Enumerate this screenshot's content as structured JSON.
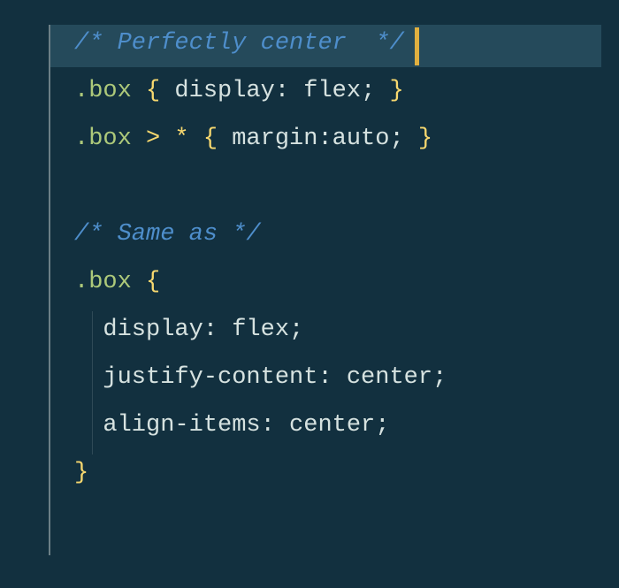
{
  "editor": {
    "lines": [
      {
        "highlighted": true,
        "tokens": [
          {
            "cls": "c-comment",
            "text": "/* Perfectly center  */"
          }
        ]
      },
      {
        "tokens": [
          {
            "cls": "c-selector",
            "text": ".box"
          },
          {
            "cls": "",
            "text": " "
          },
          {
            "cls": "c-brace",
            "text": "{"
          },
          {
            "cls": "",
            "text": " "
          },
          {
            "cls": "c-prop",
            "text": "display"
          },
          {
            "cls": "c-punct",
            "text": ":"
          },
          {
            "cls": "",
            "text": " "
          },
          {
            "cls": "c-value",
            "text": "flex"
          },
          {
            "cls": "c-punct",
            "text": ";"
          },
          {
            "cls": "",
            "text": " "
          },
          {
            "cls": "c-brace",
            "text": "}"
          }
        ]
      },
      {
        "tokens": [
          {
            "cls": "c-selector",
            "text": ".box"
          },
          {
            "cls": "",
            "text": " "
          },
          {
            "cls": "c-op",
            "text": ">"
          },
          {
            "cls": "",
            "text": " "
          },
          {
            "cls": "c-op",
            "text": "*"
          },
          {
            "cls": "",
            "text": " "
          },
          {
            "cls": "c-brace",
            "text": "{"
          },
          {
            "cls": "",
            "text": " "
          },
          {
            "cls": "c-prop",
            "text": "margin"
          },
          {
            "cls": "c-punct",
            "text": ":"
          },
          {
            "cls": "c-value",
            "text": "auto"
          },
          {
            "cls": "c-punct",
            "text": ";"
          },
          {
            "cls": "",
            "text": " "
          },
          {
            "cls": "c-brace",
            "text": "}"
          }
        ]
      },
      {
        "blank": true
      },
      {
        "tokens": [
          {
            "cls": "c-comment",
            "text": "/* Same as */"
          }
        ]
      },
      {
        "tokens": [
          {
            "cls": "c-selector",
            "text": ".box"
          },
          {
            "cls": "",
            "text": " "
          },
          {
            "cls": "c-brace",
            "text": "{"
          }
        ]
      },
      {
        "indent": 1,
        "tokens": [
          {
            "cls": "",
            "text": "  "
          },
          {
            "cls": "c-prop",
            "text": "display"
          },
          {
            "cls": "c-punct",
            "text": ":"
          },
          {
            "cls": "",
            "text": " "
          },
          {
            "cls": "c-value",
            "text": "flex"
          },
          {
            "cls": "c-punct",
            "text": ";"
          }
        ]
      },
      {
        "indent": 1,
        "tokens": [
          {
            "cls": "",
            "text": "  "
          },
          {
            "cls": "c-prop",
            "text": "justify-content"
          },
          {
            "cls": "c-punct",
            "text": ":"
          },
          {
            "cls": "",
            "text": " "
          },
          {
            "cls": "c-value",
            "text": "center"
          },
          {
            "cls": "c-punct",
            "text": ";"
          }
        ]
      },
      {
        "indent": 1,
        "tokens": [
          {
            "cls": "",
            "text": "  "
          },
          {
            "cls": "c-prop",
            "text": "align-items"
          },
          {
            "cls": "c-punct",
            "text": ":"
          },
          {
            "cls": "",
            "text": " "
          },
          {
            "cls": "c-value",
            "text": "center"
          },
          {
            "cls": "c-punct",
            "text": ";"
          }
        ]
      },
      {
        "tokens": [
          {
            "cls": "c-brace",
            "text": "}"
          }
        ]
      }
    ]
  }
}
